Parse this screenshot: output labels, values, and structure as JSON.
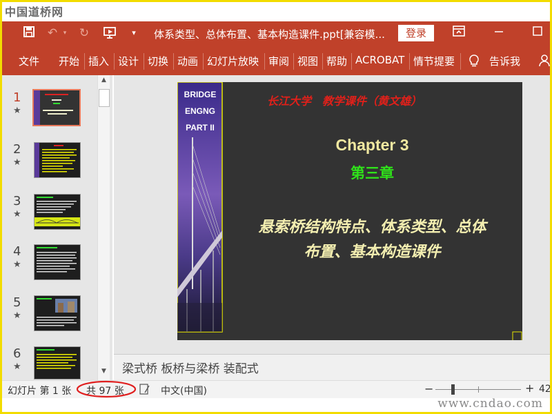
{
  "watermark_top": "中国道桥网",
  "watermark_bottom": "www.cndao.com",
  "titlebar": {
    "doc_title": "体系类型、总体布置、基本构造课件.ppt[兼容模...",
    "login_label": "登录",
    "icons": [
      "save-icon",
      "undo-icon",
      "redo-icon",
      "present-from-start-icon",
      "customize-qat-icon",
      "ribbon-display-icon",
      "minimize-icon",
      "maximize-icon"
    ]
  },
  "ribbon": {
    "tabs": [
      "文件",
      "开始",
      "插入",
      "设计",
      "切换",
      "动画",
      "幻灯片放映",
      "审阅",
      "视图",
      "帮助",
      "ACROBAT",
      "情节提要"
    ],
    "tell_me": "告诉我"
  },
  "thumbnails": [
    {
      "num": "1",
      "star": "★"
    },
    {
      "num": "2",
      "star": "★"
    },
    {
      "num": "3",
      "star": "★"
    },
    {
      "num": "4",
      "star": "★"
    },
    {
      "num": "5",
      "star": "★"
    },
    {
      "num": "6",
      "star": "★"
    }
  ],
  "slide": {
    "side_text": [
      "BRIDGE",
      "ENGNG",
      "PART II"
    ],
    "header": "长江大学　教学课件（黄文雄）",
    "chapter_en": "Chapter 3",
    "chapter_cn": "第三章",
    "title_line1": "悬索桥结构特点、体系类型、总体",
    "title_line2": "布置、基本构造课件"
  },
  "notes": "梁式桥  板桥与梁桥  装配式",
  "status": {
    "slide_label": "幻灯片 第 1 张",
    "total_label": "共 97 张",
    "language": "中文(中国)",
    "zoom_minus": "−",
    "zoom_plus": "+",
    "zoom_value": "42"
  },
  "colors": {
    "ribbon": "#c0412a",
    "slide_bg": "#333333",
    "slide_header": "#e0201a",
    "chapter_en": "#f0e8a0",
    "chapter_cn": "#2fe21a",
    "title_text": "#f3eeb0",
    "highlight_circle": "#e02020"
  }
}
